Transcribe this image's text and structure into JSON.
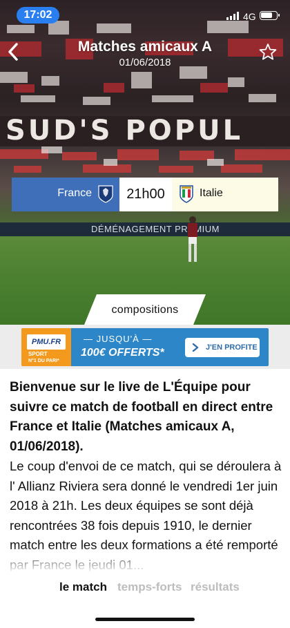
{
  "status_bar": {
    "time": "17:02",
    "network": "4G"
  },
  "header": {
    "title": "Matches amicaux A",
    "date": "01/06/2018"
  },
  "stadium": {
    "banner_text": "SUD'S POPUL",
    "board_text": "DÉMÉNAGEMENT  PREMIUM"
  },
  "match": {
    "home_team": "France",
    "kickoff": "21h00",
    "away_team": "Italie",
    "home_color": "#3f6fb8",
    "away_color": "#fdfbe6"
  },
  "compositions_tab": "compositions",
  "ad": {
    "brand": "PMU.FR",
    "brand_sport": "SPORT",
    "brand_tagline": "N°1 DU PARI*",
    "line1": "— JUSQU'À —",
    "line2": "100€ OFFERTS*",
    "cta": "J'EN PROFITE"
  },
  "article": {
    "lead": "Bienvenue sur le live de L'Équipe pour suivre ce match de football en direct entre France et Italie (Matches amicaux A, 01/06/2018).",
    "body": "Le coup d'envoi de ce match, qui se déroulera à l' Allianz Riviera sera donné le vendredi 1er juin 2018 à 21h. Les deux équipes se sont déjà rencontrées 38 fois depuis 1910, le dernier match entre les deux formations a été remporté par France le jeudi 01..."
  },
  "bottom_tabs": {
    "match": "le match",
    "temps_forts": "temps-forts",
    "resultats": "résultats"
  }
}
